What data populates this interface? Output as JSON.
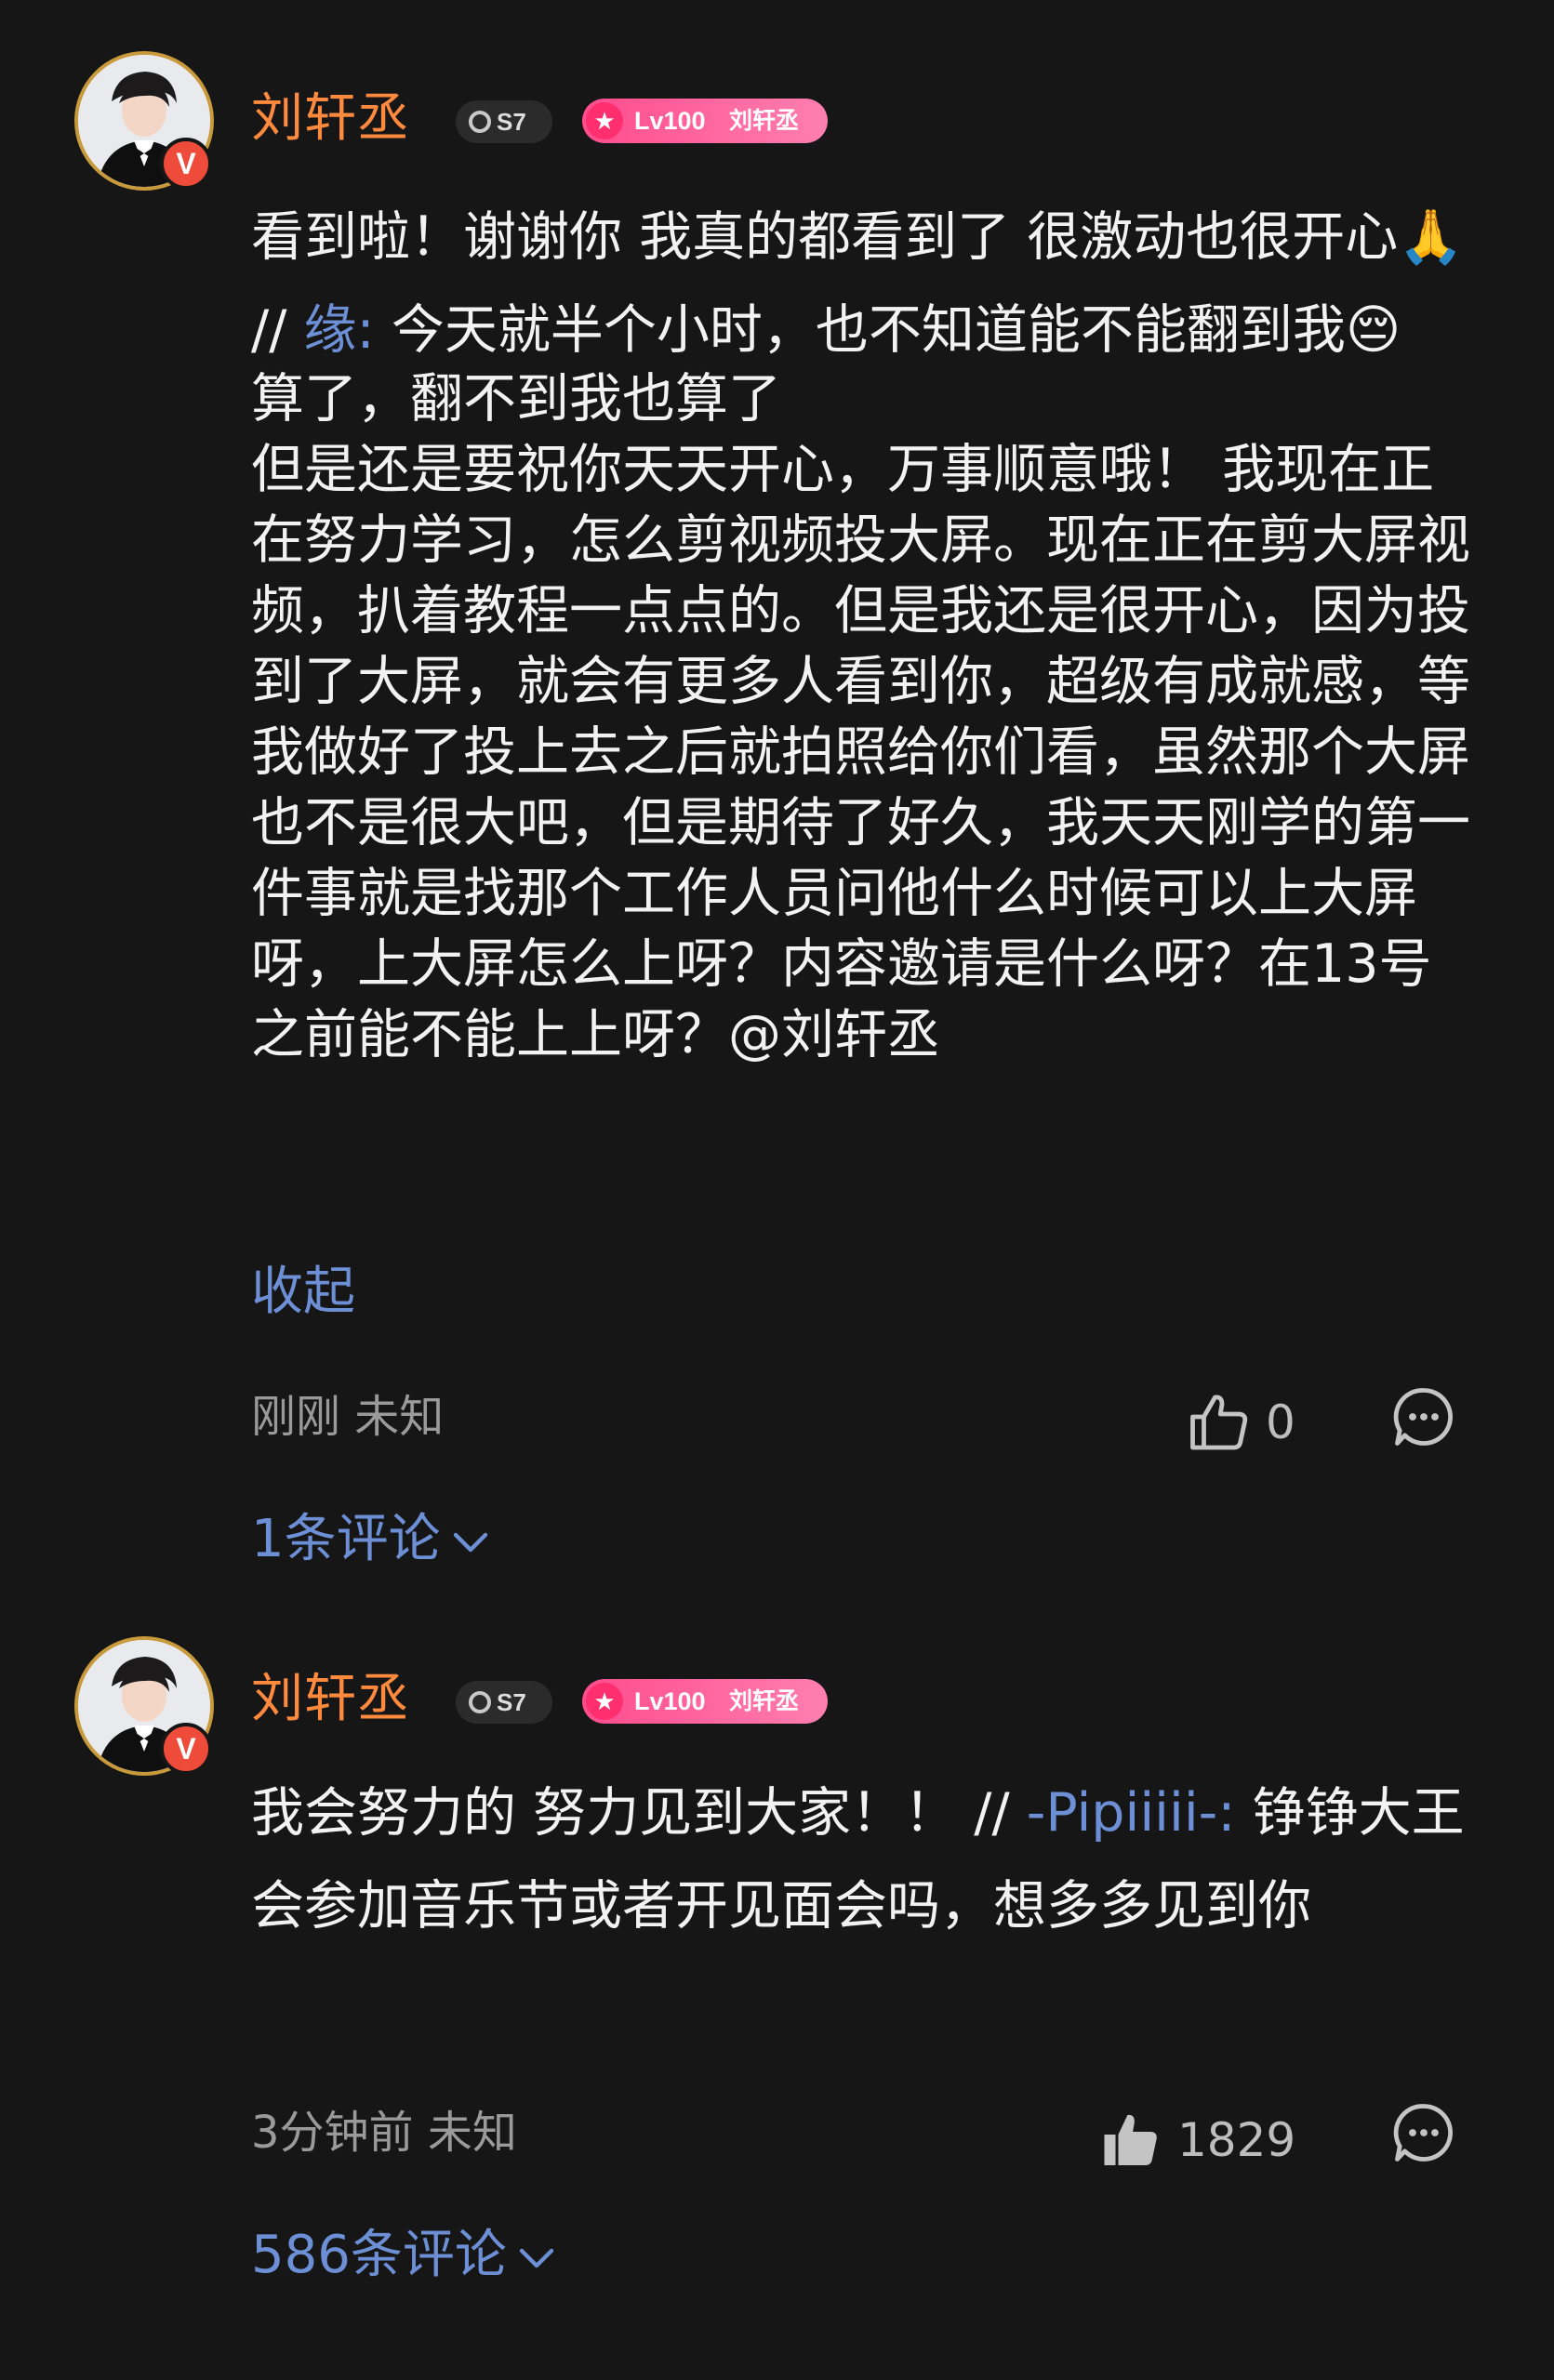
{
  "comments": [
    {
      "user": {
        "name": "刘轩丞",
        "verified_badge": "V",
        "level_badge": "S7",
        "fan_badge": {
          "level": "Lv100",
          "name": "刘轩丞"
        }
      },
      "reply_prefix": "看到啦！谢谢你 我真的都看到了 很激动也很开心🙏 //",
      "repost_user": "缘:",
      "quoted_text": " 今天就半个小时，也不知道能不能翻到我😔",
      "extra_lines": [
        "算了，翻不到我也算了",
        "但是还是要祝你天天开心，万事顺意哦！ 我现在正在努力学习，怎么剪视频投大屏。现在正在剪大屏视频，扒着教程一点点的。但是我还是很开心，因为投到了大屏，就会有更多人看到你，超级有成就感，等我做好了投上去之后就拍照给你们看，虽然那个大屏也不是很大吧，但是期待了好久，我天天刚学的第一件事就是找那个工作人员问他什么时候可以上大屏呀，上大屏怎么上呀？内容邀请是什么呀？在13号之前能不能上上呀？@刘轩丞"
      ],
      "collapse_label": "收起",
      "time": "刚刚",
      "location": "未知",
      "likes": "0",
      "liked": false,
      "replies_label": "1条评论"
    },
    {
      "user": {
        "name": "刘轩丞",
        "verified_badge": "V",
        "level_badge": "S7",
        "fan_badge": {
          "level": "Lv100",
          "name": "刘轩丞"
        }
      },
      "reply_prefix": "我会努力的 努力见到大家！！ //",
      "repost_user": "-Pipiiiii-:",
      "quoted_text": " 铮铮大王会参加音乐节或者开见面会吗，想多多见到你",
      "time": "3分钟前",
      "location": "未知",
      "likes": "1829",
      "liked": true,
      "replies_label": "586条评论"
    }
  ],
  "colors": {
    "background": "#161616",
    "username": "#ff8a3d",
    "link": "#6d8fd6",
    "meta": "#9a9a9a",
    "fan_badge": "#ff4c8d",
    "verified": "#ef4b3a",
    "avatar_ring": "#c99a3b"
  },
  "icons": {
    "like": "thumbs-up-outline-icon",
    "liked": "thumbs-up-filled-icon",
    "reply": "chat-bubble-icon",
    "expand": "chevron-down-icon"
  }
}
